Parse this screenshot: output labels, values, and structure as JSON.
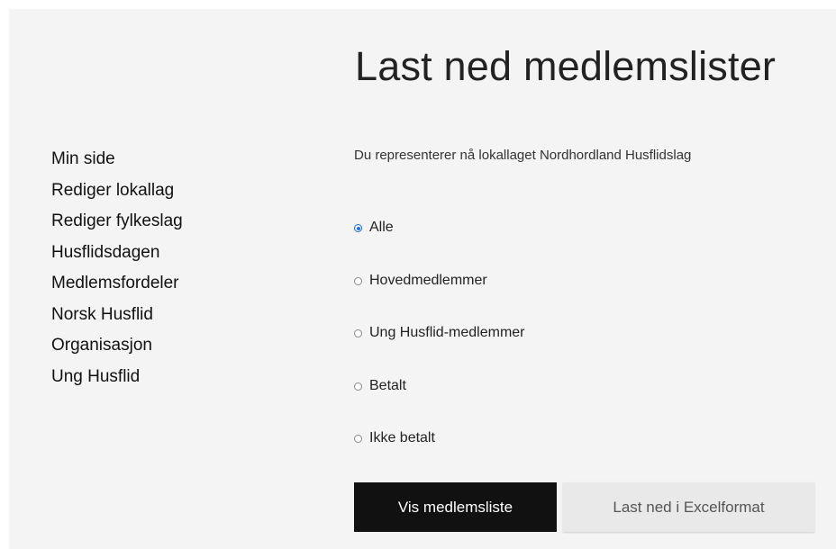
{
  "page": {
    "title": "Last ned medlemslister",
    "representation_text": "Du representerer nå lokallaget Nordhordland Husflidslag"
  },
  "sidebar": {
    "items": [
      {
        "label": "Min side"
      },
      {
        "label": "Rediger lokallag"
      },
      {
        "label": "Rediger fylkeslag"
      },
      {
        "label": "Husflidsdagen"
      },
      {
        "label": "Medlemsfordeler"
      },
      {
        "label": "Norsk Husflid"
      },
      {
        "label": "Organisasjon"
      },
      {
        "label": "Ung Husflid"
      }
    ]
  },
  "filter": {
    "selected": "Alle",
    "options": [
      {
        "label": "Alle"
      },
      {
        "label": "Hovedmedlemmer"
      },
      {
        "label": "Ung Husflid-medlemmer"
      },
      {
        "label": "Betalt"
      },
      {
        "label": "Ikke betalt"
      }
    ]
  },
  "actions": {
    "show_label": "Vis medlemsliste",
    "download_label": "Last ned i Excelformat"
  },
  "colors": {
    "panel_bg": "#f4f4f4",
    "primary_button": "#111111",
    "secondary_button": "#e9e9e9",
    "radio_accent": "#1a73e8"
  }
}
